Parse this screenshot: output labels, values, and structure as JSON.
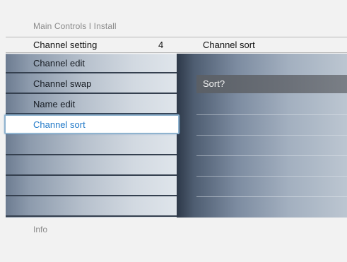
{
  "header": {
    "breadcrumb": "Main Controls I Install",
    "title": "Channel setting",
    "count": "4",
    "subtitle": "Channel sort"
  },
  "menu": {
    "items": [
      {
        "label": "Channel edit",
        "selected": false
      },
      {
        "label": "Channel swap",
        "selected": false
      },
      {
        "label": "Name edit",
        "selected": false
      },
      {
        "label": "Channel sort",
        "selected": true
      },
      {
        "label": "",
        "selected": false
      },
      {
        "label": "",
        "selected": false
      },
      {
        "label": "",
        "selected": false
      },
      {
        "label": "",
        "selected": false
      }
    ]
  },
  "content": {
    "highlight_label": "Sort?"
  },
  "footer": {
    "info": "Info"
  },
  "colors": {
    "selected_text": "#1f78c8",
    "selected_border": "#8fb3cf"
  }
}
